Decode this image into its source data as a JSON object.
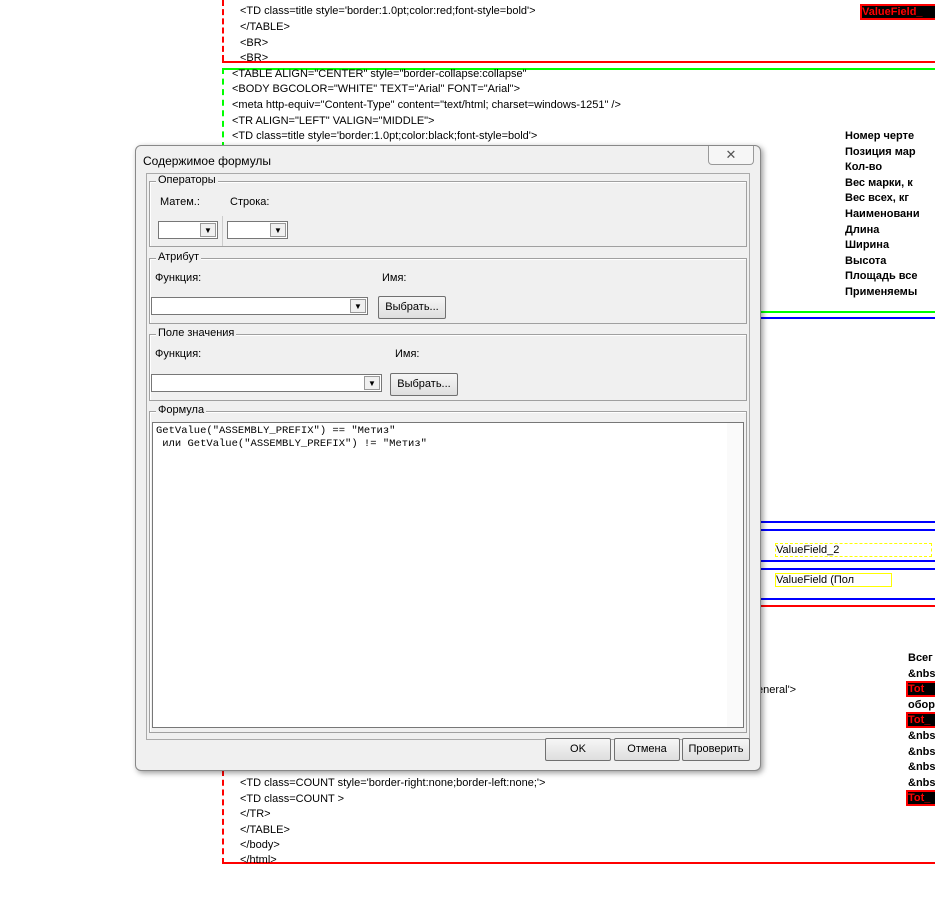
{
  "background": {
    "code_top": [
      "<TD class=title style='border:1.0pt;color:red;font-style=bold'>",
      "</TABLE>",
      "<BR>",
      "<BR>"
    ],
    "code_mid": [
      "<TABLE  ALIGN=\"CENTER\"   style=\"border-collapse:collapse\"",
      "<BODY BGCOLOR=\"WHITE\" TEXT=\"Arial\"  FONT=\"Arial\">",
      "<meta http-equiv=\"Content-Type\" content=\"text/html; charset=windows-1251\" />",
      "<TR ALIGN=\"LEFT\" VALIGN=\"MIDDLE\">",
      "<TD class=title style='border:1.0pt;color:black;font-style=bold'>"
    ],
    "code_bottom": [
      "<TD class=COUNT style='border-right:none;border-left:none;'>",
      "<TD class=COUNT >",
      "</TR>",
      "</TABLE>",
      "</body>",
      "</html>"
    ],
    "code_general": "eneral'>",
    "value_field_top": "ValueField_",
    "headers": [
      "Номер черте",
      "Позиция мар",
      "Кол-во",
      "Вес марки, к",
      "Вес всех, кг",
      "Наименовани",
      "Длина",
      "Ширина",
      "Высота",
      "Площадь все",
      "Применяемы"
    ],
    "value_field_2": "ValueField_2",
    "value_field_pol": "ValueField (Пол",
    "right_bottom": [
      {
        "t": "Всег",
        "red": false
      },
      {
        "t": "&nbs",
        "red": false
      },
      {
        "t": "Tot",
        "red": true
      },
      {
        "t": "обор",
        "red": false
      },
      {
        "t": "Tot_",
        "red": true
      },
      {
        "t": "&nbs",
        "red": false
      },
      {
        "t": "&nbs",
        "red": false
      },
      {
        "t": "&nbs",
        "red": false
      },
      {
        "t": "&nbs",
        "red": false
      },
      {
        "t": "Tot_",
        "red": true
      }
    ]
  },
  "dialog": {
    "title": "Содержимое формулы",
    "close_icon": "x-icon",
    "operators": {
      "legend": "Операторы",
      "math_label": "Матем.:",
      "string_label": "Строка:",
      "math_value": "",
      "string_value": ""
    },
    "attribute": {
      "legend": "Атрибут",
      "function_label": "Функция:",
      "name_label": "Имя:",
      "function_value": "",
      "select_button": "Выбрать..."
    },
    "value_field": {
      "legend": "Поле значения",
      "function_label": "Функция:",
      "name_label": "Имя:",
      "function_value": "",
      "select_button": "Выбрать..."
    },
    "formula": {
      "legend": "Формула",
      "text": "GetValue(\"ASSEMBLY_PREFIX\") == \"Метиз\"\n или GetValue(\"ASSEMBLY_PREFIX\") != \"Метиз\""
    },
    "buttons": {
      "ok": "OK",
      "cancel": "Отмена",
      "check": "Проверить"
    }
  },
  "colors": {
    "red": "#ff0000",
    "green": "#00ff00",
    "blue": "#0000ff",
    "yellow": "#ffff00"
  }
}
